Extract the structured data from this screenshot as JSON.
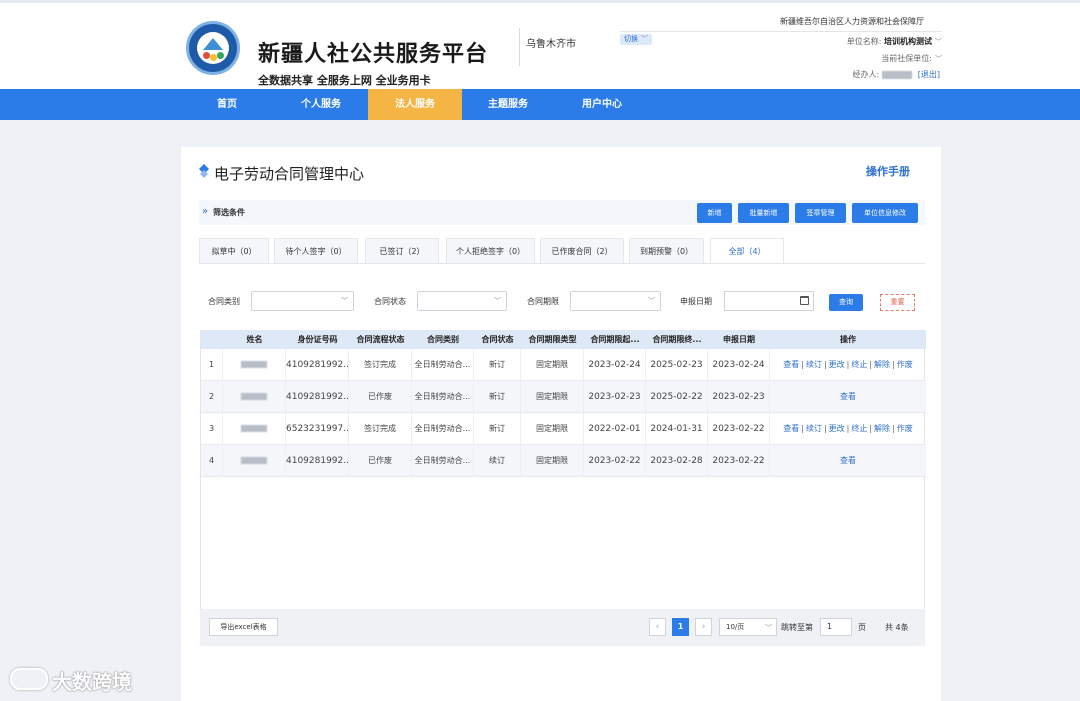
{
  "header": {
    "site_title": "新疆人社公共服务平台",
    "site_sub": "全数据共享  全服务上网  全业务用卡",
    "city": "乌鲁木齐市",
    "switch_label": "切换",
    "org": "新疆维吾尔自治区人力资源和社会保障厅",
    "unit_label": "单位名称:",
    "unit_value": "培训机构测试",
    "social_label": "当前社保单位:",
    "agent_label": "经办人:",
    "logout": "[退出]"
  },
  "nav": [
    {
      "label": "首页"
    },
    {
      "label": "个人服务"
    },
    {
      "label": "法人服务",
      "active": true
    },
    {
      "label": "主题服务"
    },
    {
      "label": "用户中心"
    }
  ],
  "page": {
    "title": "电子劳动合同管理中心",
    "manual": "操作手册",
    "filter_label": "筛选条件",
    "buttons": {
      "add": "新增",
      "batch_add": "批量新增",
      "sign_mgmt": "签章管理",
      "unit_info": "单位信息修改"
    }
  },
  "tabs": [
    {
      "label": "拟草中（0）"
    },
    {
      "label": "待个人签字（0）"
    },
    {
      "label": "已签订（2）"
    },
    {
      "label": "个人拒绝签字（0）"
    },
    {
      "label": "已作废合同（2）"
    },
    {
      "label": "到期预警（0）"
    },
    {
      "label": "全部（4）",
      "active": true
    }
  ],
  "query": {
    "contract_type": "合同类别",
    "contract_status": "合同状态",
    "contract_term": "合同期限",
    "report_date": "申报日期",
    "query_btn": "查询",
    "reset_btn": "重置"
  },
  "table": {
    "headers": [
      "",
      "姓名",
      "身份证号码",
      "合同流程状态",
      "合同类别",
      "合同状态",
      "合同期限类型",
      "合同期限起...",
      "合同期限终...",
      "申报日期",
      "操作"
    ],
    "rows": [
      {
        "no": "1",
        "id": "4109281992...",
        "flow": "签订完成",
        "type": "全日制劳动合...",
        "status": "新订",
        "term": "固定期限",
        "start": "2023-02-24",
        "end": "2025-02-23",
        "date": "2023-02-24",
        "ops": "full"
      },
      {
        "no": "2",
        "id": "4109281992...",
        "flow": "已作废",
        "type": "全日制劳动合...",
        "status": "新订",
        "term": "固定期限",
        "start": "2023-02-23",
        "end": "2025-02-22",
        "date": "2023-02-23",
        "ops": "view"
      },
      {
        "no": "3",
        "id": "6523231997...",
        "flow": "签订完成",
        "type": "全日制劳动合...",
        "status": "新订",
        "term": "固定期限",
        "start": "2022-02-01",
        "end": "2024-01-31",
        "date": "2023-02-22",
        "ops": "full"
      },
      {
        "no": "4",
        "id": "4109281992...",
        "flow": "已作废",
        "type": "全日制劳动合...",
        "status": "续订",
        "term": "固定期限",
        "start": "2023-02-22",
        "end": "2023-02-28",
        "date": "2023-02-22",
        "ops": "view"
      }
    ],
    "op_labels": {
      "view": "查看",
      "renew": "续订",
      "change": "更改",
      "terminate": "终止",
      "cancel": "解除",
      "void": "作废"
    }
  },
  "pager": {
    "export": "导出excel表格",
    "prev": "‹",
    "current": "1",
    "next": "›",
    "size": "10/页",
    "goto": "跳转至第",
    "goto_value": "1",
    "page_unit": "页",
    "total": "共 4条"
  },
  "watermark": "大数跨境"
}
